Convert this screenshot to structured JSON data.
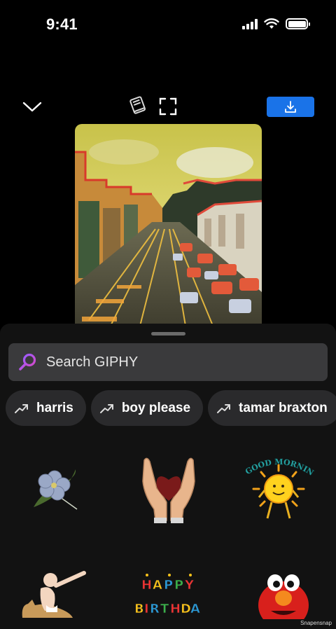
{
  "status_bar": {
    "time": "9:41",
    "signal_icon": "cellular-signal-icon",
    "wifi_icon": "wifi-icon",
    "battery_icon": "battery-icon"
  },
  "toolbar": {
    "collapse_icon": "chevron-down-icon",
    "library_icon": "book-icon",
    "fullscreen_icon": "expand-icon",
    "download_icon": "download-icon",
    "accent_color": "#1a73e8"
  },
  "preview": {
    "description_icon": "city-street-gif"
  },
  "search": {
    "placeholder": "Search GIPHY",
    "icon": "search-icon"
  },
  "trending": [
    {
      "label": "harris",
      "icon": "trending-icon"
    },
    {
      "label": "boy please",
      "icon": "trending-icon"
    },
    {
      "label": "tamar braxton",
      "icon": "trending-icon"
    }
  ],
  "stickers": [
    {
      "name": "flower-sticker"
    },
    {
      "name": "heart-hands-sticker"
    },
    {
      "name": "good-morning-sun-sticker",
      "text": "GOOD MORNING"
    },
    {
      "name": "baby-cat-sticker"
    },
    {
      "name": "happy-birthday-sticker",
      "text_top": "HAPPY",
      "text_bottom": "BIRTHDAY"
    },
    {
      "name": "elmo-sticker"
    }
  ],
  "watermark": "Snapensnap"
}
